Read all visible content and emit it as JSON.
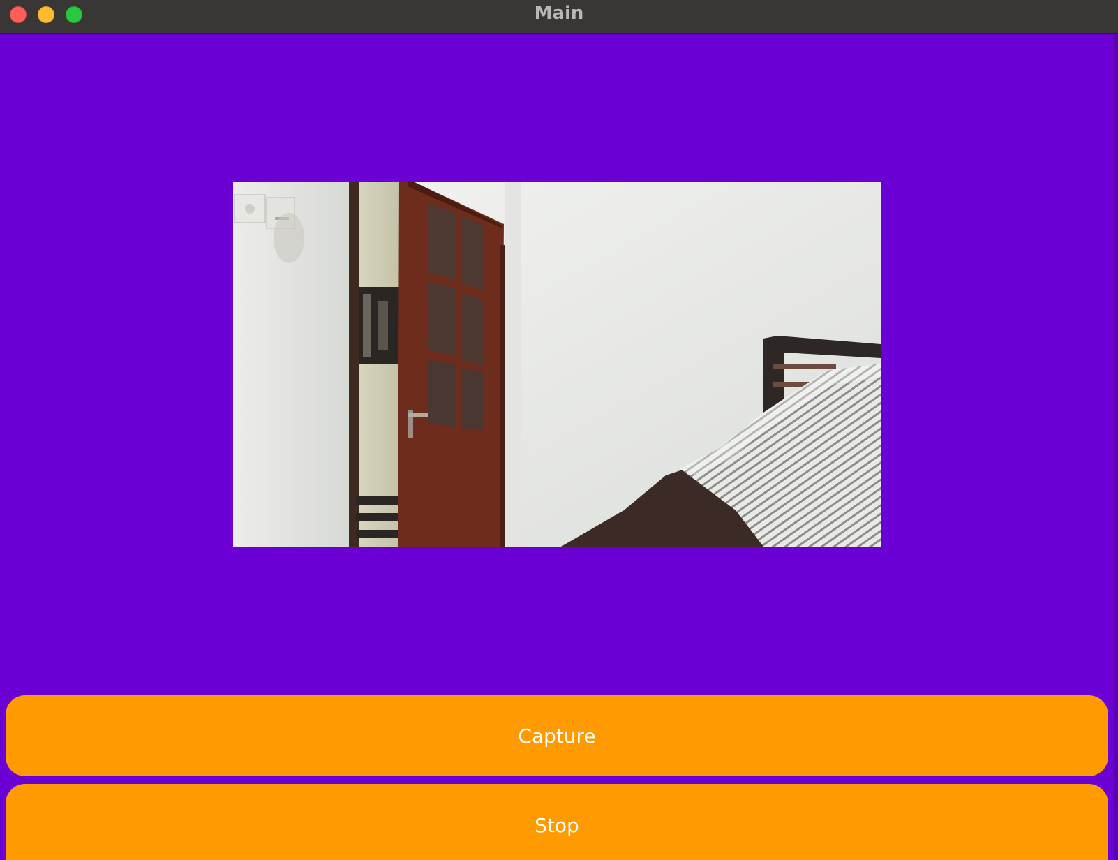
{
  "window": {
    "title": "Main"
  },
  "camera": {
    "feed_description": ""
  },
  "buttons": {
    "capture_label": "Capture",
    "stop_label": "Stop"
  },
  "colors": {
    "background": "#6A00D4",
    "button": "#FF9A00",
    "button_text": "#FFFFFF",
    "titlebar": "#393735"
  }
}
